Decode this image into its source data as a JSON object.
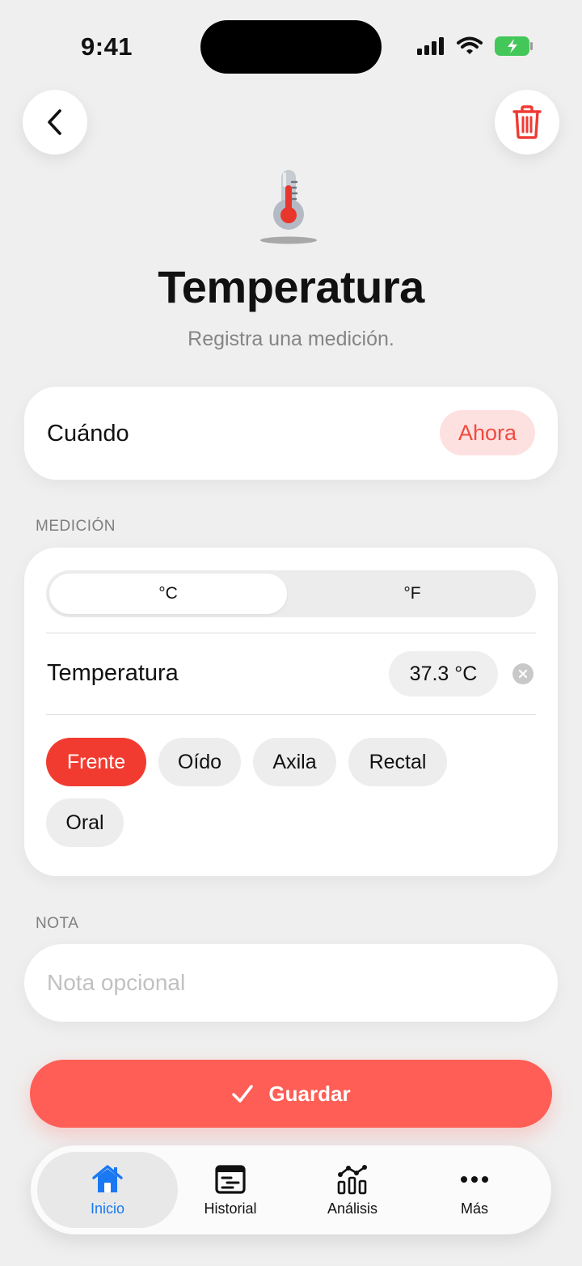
{
  "status_bar": {
    "time": "9:41"
  },
  "header": {
    "icon": "thermometer-icon",
    "title": "Temperatura",
    "subtitle": "Registra una medición."
  },
  "when": {
    "label": "Cuándo",
    "value": "Ahora"
  },
  "measurement": {
    "section_label": "MEDICIÓN",
    "units": [
      "°C",
      "°F"
    ],
    "selected_unit": "°C",
    "field_label": "Temperatura",
    "value": "37.3 °C",
    "sites": [
      "Frente",
      "Oído",
      "Axila",
      "Rectal",
      "Oral"
    ],
    "selected_site": "Frente"
  },
  "note": {
    "section_label": "NOTA",
    "placeholder": "Nota opcional",
    "value": ""
  },
  "save_button": {
    "label": "Guardar"
  },
  "tab_bar": {
    "tabs": [
      {
        "label": "Inicio",
        "icon": "home-icon",
        "active": true
      },
      {
        "label": "Historial",
        "icon": "history-icon",
        "active": false
      },
      {
        "label": "Análisis",
        "icon": "analysis-icon",
        "active": false
      },
      {
        "label": "Más",
        "icon": "more-icon",
        "active": false
      }
    ]
  },
  "colors": {
    "accent": "#F23B30",
    "save": "#FE5E55",
    "tab_active": "#1A78F2",
    "background": "#EFEFEF"
  }
}
